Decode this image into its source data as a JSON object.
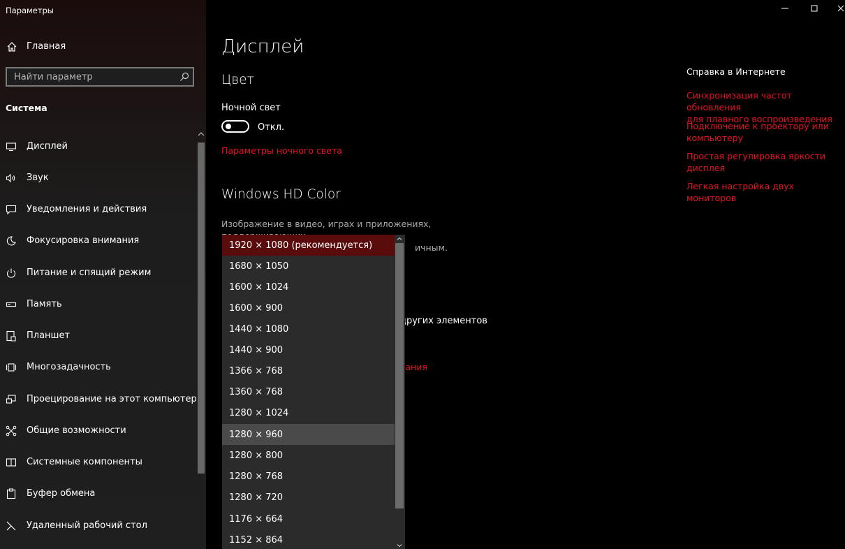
{
  "window": {
    "title": "Параметры",
    "controls": [
      "minimize-icon",
      "maximize-icon",
      "close-icon"
    ]
  },
  "sidebar": {
    "home_label": "Главная",
    "search_placeholder": "Найти параметр",
    "section_title": "Система",
    "items": [
      {
        "label": "Дисплей",
        "icon": "display-icon"
      },
      {
        "label": "Звук",
        "icon": "sound-icon"
      },
      {
        "label": "Уведомления и действия",
        "icon": "notifications-icon"
      },
      {
        "label": "Фокусировка внимания",
        "icon": "focus-moon-icon"
      },
      {
        "label": "Питание и спящий режим",
        "icon": "power-icon"
      },
      {
        "label": "Память",
        "icon": "storage-icon"
      },
      {
        "label": "Планшет",
        "icon": "tablet-icon"
      },
      {
        "label": "Многозадачность",
        "icon": "multitasking-icon"
      },
      {
        "label": "Проецирование на этот компьютер",
        "icon": "projecting-icon"
      },
      {
        "label": "Общие возможности",
        "icon": "shared-experiences-icon"
      },
      {
        "label": "Системные компоненты",
        "icon": "components-icon"
      },
      {
        "label": "Буфер обмена",
        "icon": "clipboard-icon"
      },
      {
        "label": "Удаленный рабочий стол",
        "icon": "remote-desktop-icon"
      }
    ]
  },
  "main": {
    "title": "Дисплей",
    "color_heading": "Цвет",
    "night_light_label": "Ночной свет",
    "night_light_state": "Откл.",
    "night_light_link": "Параметры ночного света",
    "hdr_heading": "Windows HD Color",
    "hdr_desc_line1": "Изображение в видео, играх и приложениях, поддерживающих",
    "hdr_desc_line2_partial": "ичным.",
    "partial_text": "других элементов",
    "partial_link": "вания"
  },
  "resolution_dropdown": {
    "selected_index": 0,
    "hover_index": 9,
    "options": [
      "1920 × 1080 (рекомендуется)",
      "1680 × 1050",
      "1600 × 1024",
      "1600 × 900",
      "1440 × 1080",
      "1440 × 900",
      "1366 × 768",
      "1360 × 768",
      "1280 × 1024",
      "1280 × 960",
      "1280 × 800",
      "1280 × 768",
      "1280 × 720",
      "1176 × 664",
      "1152 × 864"
    ]
  },
  "help": {
    "title": "Справка в Интернете",
    "links": [
      {
        "line1": "Синхронизация частот обновления",
        "line2": "для плавного воспроизведения"
      },
      {
        "line1": "Подключение к проектору или",
        "line2": "компьютеру"
      },
      {
        "line1": "Простая регулировка яркости",
        "line2": "дисплея"
      },
      {
        "line1": "Легкая настройка двух мониторов",
        "line2": ""
      }
    ]
  },
  "colors": {
    "accent_link": "#e81123",
    "selected_option_bg": "#5a0b0b",
    "hover_option_bg": "#4a4a4a"
  }
}
